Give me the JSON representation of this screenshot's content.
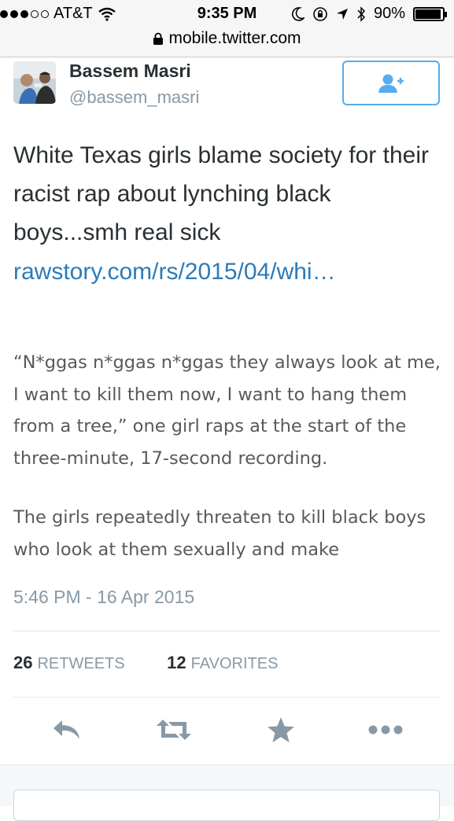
{
  "status_bar": {
    "carrier": "AT&T",
    "signal_bars": 3,
    "time": "9:35 PM",
    "battery": "90%"
  },
  "url_bar": {
    "url": "mobile.twitter.com"
  },
  "tweet": {
    "author_name": "Bassem Masri",
    "author_handle": "@bassem_masri",
    "text": "White Texas girls blame society for their racist rap about lynching black boys...smh real sick",
    "link": "rawstory.com/rs/2015/04/whi…",
    "quote_lines_1": [
      "“N*ggas n*ggas n*ggas they always look at me,",
      "I want to kill them now, I want to hang them",
      "from a tree,” one girl raps at the start of the",
      "three-minute, 17-second recording."
    ],
    "quote_lines_2": [
      "The girls repeatedly threaten to kill black boys",
      "who look at them sexually and make"
    ],
    "timestamp": "5:46 PM - 16 Apr 2015",
    "retweets_count": "26",
    "retweets_label": "RETWEETS",
    "favorites_count": "12",
    "favorites_label": "FAVORITES"
  },
  "icons": [
    "wifi-icon",
    "moon-icon",
    "rotation-lock-icon",
    "location-icon",
    "bluetooth-icon",
    "battery-icon",
    "lock-icon",
    "follow-icon",
    "reply-icon",
    "retweet-icon",
    "favorite-icon",
    "more-icon"
  ],
  "colors": {
    "link": "#2b7bb9",
    "follow_border": "#55acee",
    "action_icon": "#8899a6",
    "muted_text": "#8899a6"
  }
}
